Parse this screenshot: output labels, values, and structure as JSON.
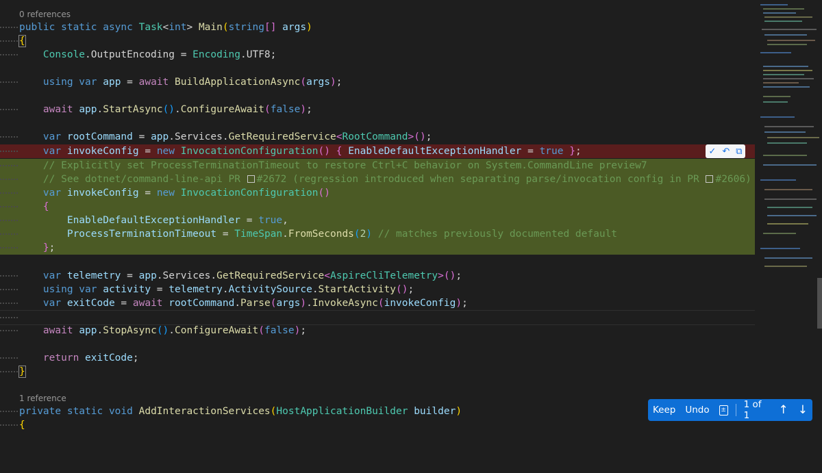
{
  "codelens": {
    "main_refs": "0 references",
    "interaction_refs": "1 reference"
  },
  "code": {
    "l_main_a": "public static async ",
    "l_main_b": "Task",
    "l_main_c": "<",
    "l_main_d": "int",
    "l_main_e": "> ",
    "l_main_f": "Main",
    "l_main_g": "(",
    "l_main_h": "string",
    "l_main_i": "[]",
    "l_main_j": " args",
    "l_main_k": ")",
    "brace_open": "{",
    "brace_close": "}",
    "console_a": "Console",
    "console_b": ".OutputEncoding = ",
    "console_c": "Encoding",
    "console_d": ".UTF8;",
    "using_a": "using var ",
    "using_b": "app",
    "using_c": " = ",
    "using_d": "await ",
    "using_e": "BuildApplicationAsync",
    "using_f": "(",
    "using_g": "args",
    "using_h": ");",
    "start_a": "await ",
    "start_b": "app",
    "start_c": ".",
    "start_d": "StartAsync",
    "start_e": "()",
    "start_f": ".",
    "start_g": "ConfigureAwait",
    "start_h": "(",
    "start_i": "false",
    "start_j": ");",
    "root_a": "var ",
    "root_b": "rootCommand",
    "root_c": " = ",
    "root_d": "app",
    "root_e": ".Services.",
    "root_f": "GetRequiredService",
    "root_g": "<",
    "root_h": "RootCommand",
    "root_i": ">",
    "root_j": "()",
    "root_k": ";",
    "del_a": "var ",
    "del_b": "invokeConfig",
    "del_c": " = ",
    "del_d": "new ",
    "del_e": "InvocationConfiguration",
    "del_f": "() ",
    "del_g": "{",
    "del_h": " EnableDefaultExceptionHandler",
    "del_i": " = ",
    "del_j": "true",
    "del_k": " ",
    "del_l": "}",
    "del_m": ";",
    "cm1": "// Explicitly set ProcessTerminationTimeout to restore Ctrl+C behavior on System.CommandLine preview7",
    "cm2_a": "// See dotnet/command-line-api PR ",
    "cm2_b": "#2672 (regression introduced when separating parse/invocation config in PR ",
    "cm2_c": "#2606)",
    "add1_a": "var ",
    "add1_b": "invokeConfig",
    "add1_c": " = ",
    "add1_d": "new ",
    "add1_e": "InvocationConfiguration",
    "add1_f": "()",
    "add2": "{",
    "add3_a": "EnableDefaultExceptionHandler",
    "add3_b": " = ",
    "add3_c": "true",
    "add3_d": ",",
    "add4_a": "ProcessTerminationTimeout",
    "add4_b": " = ",
    "add4_c": "TimeSpan",
    "add4_d": ".",
    "add4_e": "FromSeconds",
    "add4_f": "(",
    "add4_g": "2",
    "add4_h": ")",
    "add4_i": " // matches previously documented default",
    "add5_a": "}",
    "add5_b": ";",
    "tel_a": "var ",
    "tel_b": "telemetry",
    "tel_c": " = ",
    "tel_d": "app",
    "tel_e": ".Services.",
    "tel_f": "GetRequiredService",
    "tel_g": "<",
    "tel_h": "AspireCliTelemetry",
    "tel_i": ">",
    "tel_j": "()",
    "tel_k": ";",
    "act_a": "using var ",
    "act_b": "activity",
    "act_c": " = ",
    "act_d": "telemetry",
    "act_e": ".",
    "act_f": "ActivitySource",
    "act_g": ".",
    "act_h": "StartActivity",
    "act_i": "()",
    "act_j": ";",
    "exit_a": "var ",
    "exit_b": "exitCode",
    "exit_c": " = ",
    "exit_d": "await ",
    "exit_e": "rootCommand",
    "exit_f": ".",
    "exit_g": "Parse",
    "exit_h": "(",
    "exit_i": "args",
    "exit_j": ")",
    "exit_k": ".",
    "exit_l": "InvokeAsync",
    "exit_m": "(",
    "exit_n": "invokeConfig",
    "exit_o": ")",
    "exit_p": ";",
    "stop_a": "await ",
    "stop_b": "app",
    "stop_c": ".",
    "stop_d": "StopAsync",
    "stop_e": "()",
    "stop_f": ".",
    "stop_g": "ConfigureAwait",
    "stop_h": "(",
    "stop_i": "false",
    "stop_j": ");",
    "ret_a": "return ",
    "ret_b": "exitCode",
    "ret_c": ";",
    "priv_a": "private static void ",
    "priv_b": "AddInteractionServices",
    "priv_c": "(",
    "priv_d": "HostApplicationBuilder",
    "priv_e": " builder",
    "priv_f": ")",
    "priv_brace": "{"
  },
  "inline_actions": {
    "accept_icon": "check-icon",
    "undo_icon": "undo-icon",
    "open_icon": "file-diff-icon"
  },
  "toolbar": {
    "keep": "Keep",
    "undo": "Undo",
    "counter": "1 of 1"
  },
  "colors": {
    "deleted_line_bg": "#5a1d1d",
    "added_block_bg": "#4b5a25",
    "toolbar_bg": "#0e6fd6"
  }
}
